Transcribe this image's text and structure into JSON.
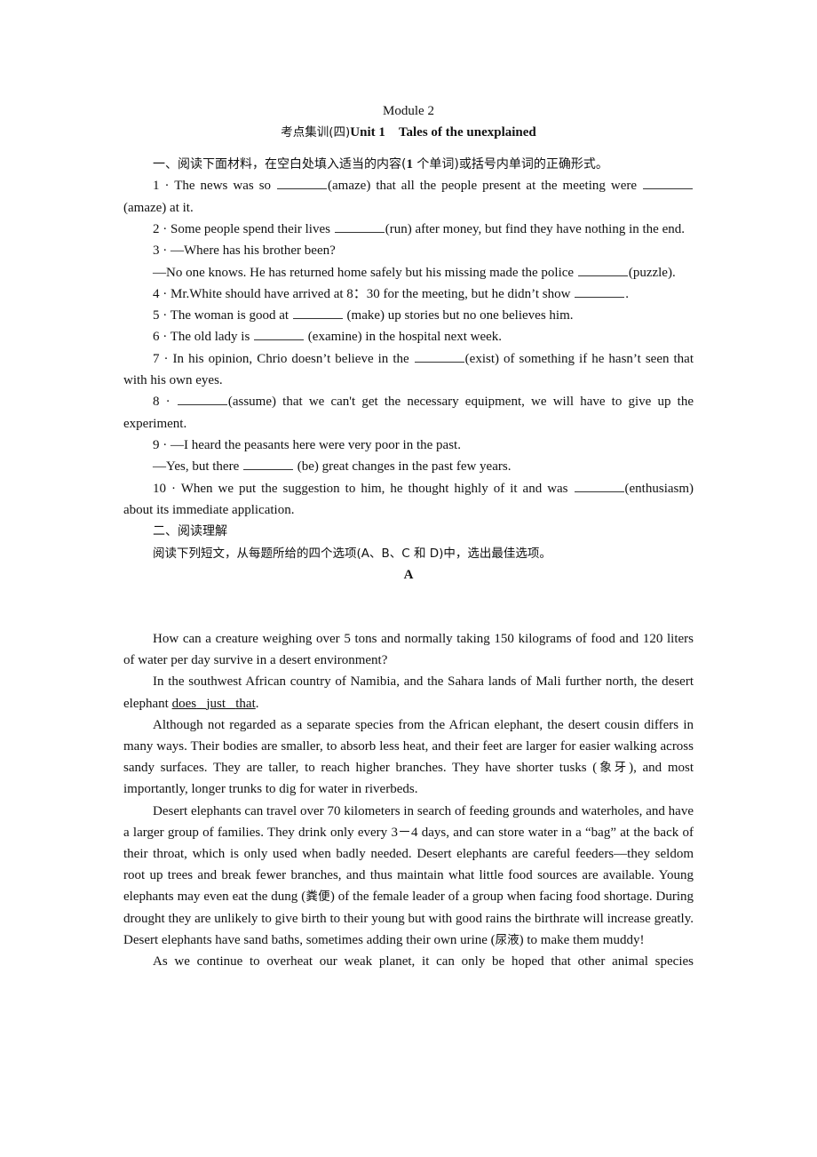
{
  "header": {
    "module": "Module 2",
    "subtitle_cn": "考点集训(四)",
    "subtitle_unit": "Unit 1",
    "subtitle_title": "Tales of the unexplained"
  },
  "section1": {
    "heading_prefix": "一、阅读下面材料，在空白处填入适当的内容(",
    "heading_num": "1",
    "heading_suffix": "个单词)或括号内单词的正确形式。",
    "items": [
      {
        "num": "1 ·",
        "a": " The news was so ",
        "b": "(amaze) that all the people present at the meeting were ",
        "c": "(amaze) at it."
      },
      {
        "num": "2 ·",
        "a": " Some people spend their lives ",
        "b": "(run) after money, but find they have nothing in the end."
      },
      {
        "num": "3 ·",
        "a": " —Where has his brother been?",
        "b": "—No one knows. He has returned home safely but his missing made the police ",
        "c": "(puzzle)."
      },
      {
        "num": "4 ·",
        "a": " Mr.White should have arrived at 8：30 for the meeting, but he didn’t show ",
        "b": "."
      },
      {
        "num": "5 ·",
        "a": " The woman is good at ",
        "b": " (make) up stories but no one believes him."
      },
      {
        "num": "6 ·",
        "a": " The old lady is ",
        "b": " (examine) in the hospital next week."
      },
      {
        "num": "7 ·",
        "a": " In his opinion, Chrio doesn’t believe in the ",
        "b": "(exist) of something if he hasn’t seen that with his own eyes."
      },
      {
        "num": "8 ·",
        "a": " ",
        "b": "(assume) that we can't get the necessary equipment, we will have to give up the experiment."
      },
      {
        "num": "9 ·",
        "a": " —I heard the peasants here were very poor in the past.",
        "b": "—Yes, but there ",
        "c": " (be) great changes in the past few years."
      },
      {
        "num": "10 ·",
        "a": " When we put the suggestion to him, he thought highly of it and was ",
        "b": "(enthusiasm) about its immediate application."
      }
    ]
  },
  "section2": {
    "heading": "二、阅读理解",
    "instruction": "阅读下列短文，从每题所给的四个选项(A、B、C 和 D)中，选出最佳选项。",
    "passage_label": "A"
  },
  "passage": {
    "p1": "How can a creature weighing over 5 tons and normally taking 150 kilograms of food and 120 liters of water per day survive in a desert environment?",
    "p2_a": "In the southwest African country of Namibia, and the Sahara lands of Mali further north, the desert elephant ",
    "p2_u1": "does",
    "p2_u2": "just",
    "p2_u3": "that",
    "p2_end": ".",
    "p3_a": "Although not regarded as a separate species from the African elephant, the desert cousin differs in many ways. Their bodies are smaller, to absorb less heat, and their feet are larger for easier walking across sandy surfaces. They are taller, to reach higher branches. They have shorter tusks (",
    "p3_cn": "象牙",
    "p3_b": "), and most importantly, longer trunks to dig for water in riverbeds.",
    "p4_a": "Desert elephants can travel over 70 kilometers in search of feeding grounds and waterholes, and have a larger group of families. They drink only every 3－4 days, and can store water in a “bag” at the back of their throat, which is only used when badly needed. Desert elephants are careful feeders—they seldom root up trees and break fewer branches, and thus maintain what little food sources are available. Young elephants may even eat the dung (",
    "p4_cn1": "粪便",
    "p4_b": ") of the female leader of a group when facing food shortage. During drought they are unlikely to give birth to their young but with good rains the birthrate will increase greatly. Desert elephants have sand baths, sometimes adding their own urine (",
    "p4_cn2": "尿液",
    "p4_c": ") to make them muddy!",
    "p5": "As we continue to overheat our weak planet, it can only be hoped that other animal species"
  }
}
